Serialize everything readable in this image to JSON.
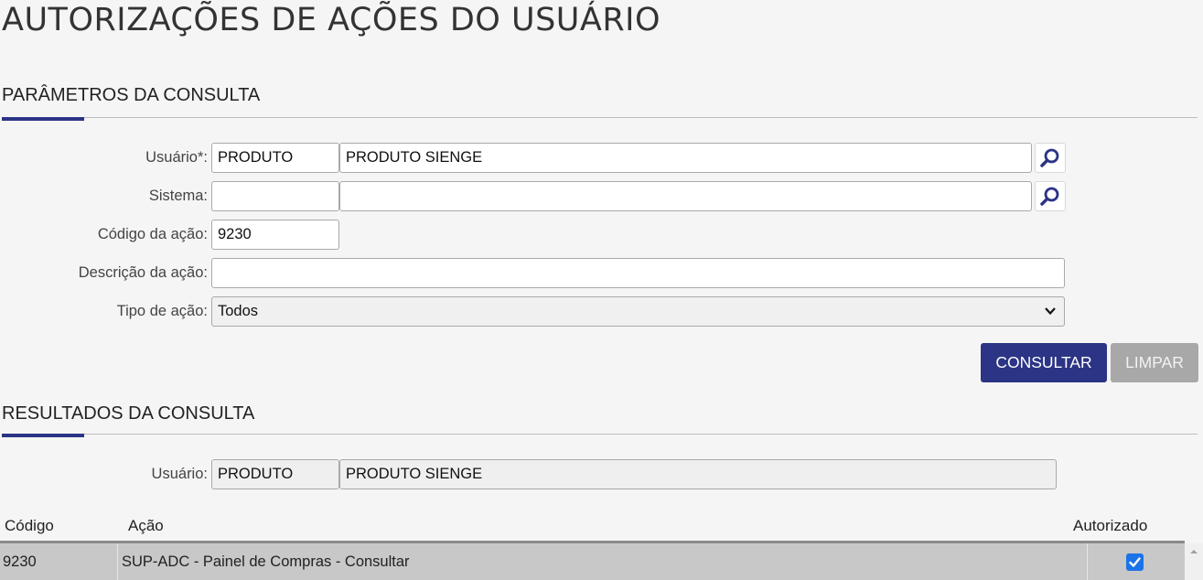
{
  "page": {
    "title": "AUTORIZAÇÕES DE AÇÕES DO USUÁRIO"
  },
  "params_section": {
    "title": "PARÂMETROS DA CONSULTA",
    "usuario": {
      "label": "Usuário*:",
      "code": "PRODUTO",
      "name": "PRODUTO SIENGE",
      "search_icon": "search-icon"
    },
    "sistema": {
      "label": "Sistema:",
      "code": "",
      "name": "",
      "search_icon": "search-icon"
    },
    "codigo_acao": {
      "label": "Código da ação:",
      "value": "9230"
    },
    "descricao_acao": {
      "label": "Descrição da ação:",
      "value": ""
    },
    "tipo_acao": {
      "label": "Tipo de ação:",
      "selected": "Todos"
    },
    "buttons": {
      "consultar": "CONSULTAR",
      "limpar": "LIMPAR"
    }
  },
  "results_section": {
    "title": "RESULTADOS DA CONSULTA",
    "usuario": {
      "label": "Usuário:",
      "code": "PRODUTO",
      "name": "PRODUTO SIENGE"
    },
    "table": {
      "columns": {
        "codigo": "Código",
        "acao": "Ação",
        "autorizado": "Autorizado"
      },
      "rows": [
        {
          "codigo": "9230",
          "acao": "SUP-ADC - Painel de Compras - Consultar",
          "autorizado": true
        }
      ]
    }
  },
  "colors": {
    "primary": "#2b3485",
    "disabled": "#a8a8a8",
    "checkbox": "#1a73e8"
  }
}
